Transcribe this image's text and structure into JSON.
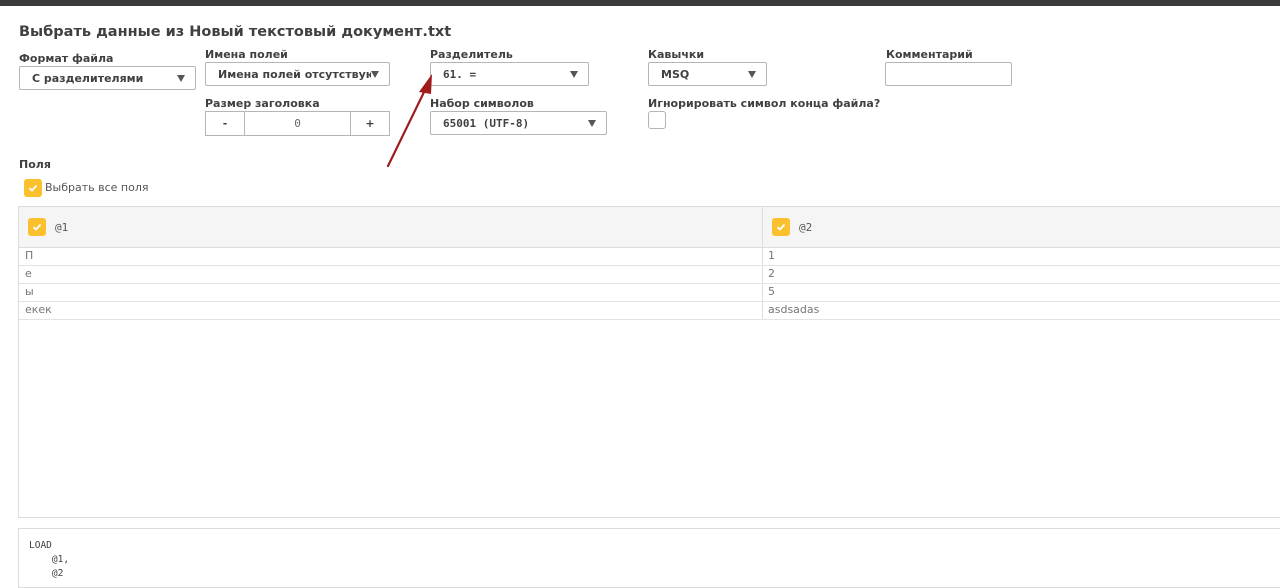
{
  "dialog": {
    "title": "Выбрать данные из Новый текстовый документ.txt"
  },
  "format": {
    "label": "Формат файла",
    "value": "С разделителями"
  },
  "field_names": {
    "label": "Имена полей",
    "value": "Имена полей отсутствуют"
  },
  "header_size": {
    "label": "Размер заголовка",
    "minus": "-",
    "value": "0",
    "plus": "+"
  },
  "delimiter": {
    "label": "Разделитель",
    "value": "61. ="
  },
  "charset": {
    "label": "Набор символов",
    "value": "65001 (UTF-8)"
  },
  "quotes": {
    "label": "Кавычки",
    "value": "MSQ"
  },
  "ignore_eof": {
    "label": "Игнорировать символ конца файла?"
  },
  "comment": {
    "label": "Комментарий",
    "value": ""
  },
  "fields": {
    "label": "Поля",
    "select_all": "Выбрать все поля"
  },
  "table": {
    "columns": [
      "@1",
      "@2"
    ],
    "rows": [
      [
        "П",
        "1"
      ],
      [
        "е",
        "2"
      ],
      [
        "ы",
        "5"
      ],
      [
        "екек",
        "asdsadas"
      ]
    ]
  },
  "script": {
    "lines": [
      "LOAD",
      "    @1,",
      "    @2"
    ]
  },
  "colors": {
    "accent": "#fbc02d",
    "annotation_arrow": "#a01c1c",
    "top_bar": "#3b3b3b"
  },
  "icons": {
    "checkbox": "checkmark-icon",
    "dropdown": "chevron-down-icon"
  }
}
